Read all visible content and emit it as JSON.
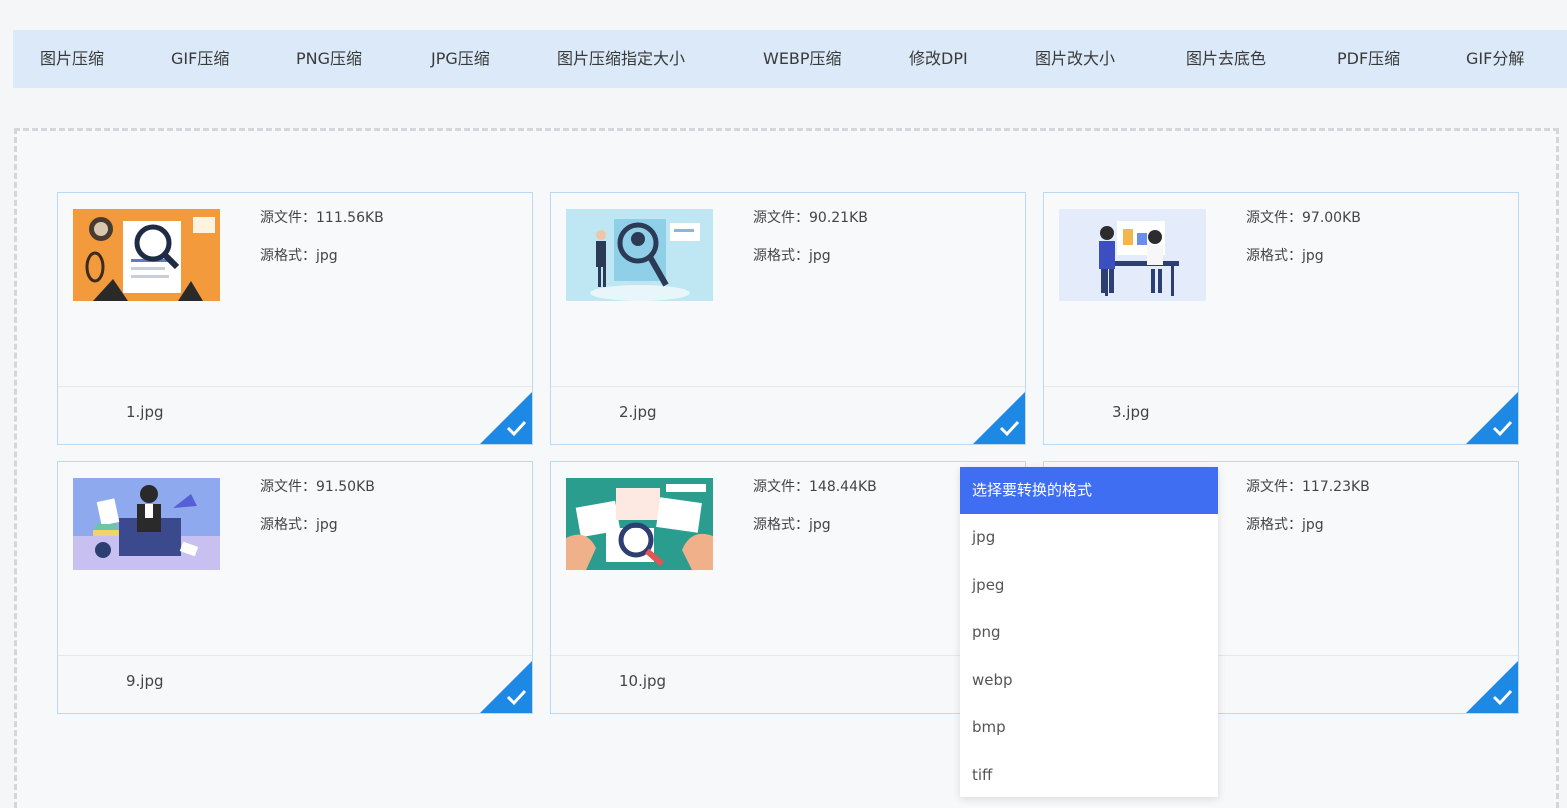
{
  "nav": {
    "items": [
      {
        "label": "图片压缩"
      },
      {
        "label": "GIF压缩"
      },
      {
        "label": "PNG压缩"
      },
      {
        "label": "JPG压缩"
      },
      {
        "label": "图片压缩指定大小"
      },
      {
        "label": "WEBP压缩"
      },
      {
        "label": "修改DPI"
      },
      {
        "label": "图片改大小"
      },
      {
        "label": "图片去底色"
      },
      {
        "label": "PDF压缩"
      },
      {
        "label": "GIF分解"
      }
    ]
  },
  "files": [
    {
      "size": "源文件：111.56KB",
      "format": "源格式：jpg",
      "name": "1.jpg",
      "checked": true
    },
    {
      "size": "源文件：90.21KB",
      "format": "源格式：jpg",
      "name": "2.jpg",
      "checked": true
    },
    {
      "size": "源文件：97.00KB",
      "format": "源格式：jpg",
      "name": "3.jpg",
      "checked": true
    },
    {
      "size": "源文件：91.50KB",
      "format": "源格式：jpg",
      "name": "9.jpg",
      "checked": true
    },
    {
      "size": "源文件：148.44KB",
      "format": "源格式：jpg",
      "name": "10.jpg",
      "checked": false
    },
    {
      "size": "源文件：117.23KB",
      "format": "源格式：jpg",
      "name": "",
      "checked": true
    }
  ],
  "format_menu": {
    "title": "选择要转换的格式",
    "options": [
      "jpg",
      "jpeg",
      "png",
      "webp",
      "bmp",
      "tiff"
    ]
  },
  "colors": {
    "accent": "#3f6ef2",
    "check": "#1e88e5",
    "nav_bg": "#dbe9f8"
  }
}
